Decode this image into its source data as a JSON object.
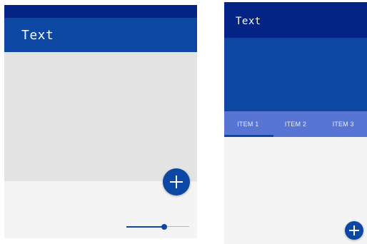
{
  "colors": {
    "primary_dark": "#032484",
    "primary": "#0c47a3",
    "primary_light": "#5875d3",
    "surface": "#f4f4f4",
    "media_placeholder": "#e3e3e3"
  },
  "left_screen": {
    "appbar": {
      "title": "Text"
    },
    "fab": {
      "icon": "plus-icon"
    },
    "slider": {
      "value": 0.6
    }
  },
  "right_screen": {
    "appbar": {
      "title": "Text"
    },
    "tabs": [
      {
        "label": "ITEM 1",
        "selected": true
      },
      {
        "label": "ITEM 2",
        "selected": false
      },
      {
        "label": "ITEM 3",
        "selected": false
      }
    ],
    "fab": {
      "icon": "plus-icon"
    }
  }
}
